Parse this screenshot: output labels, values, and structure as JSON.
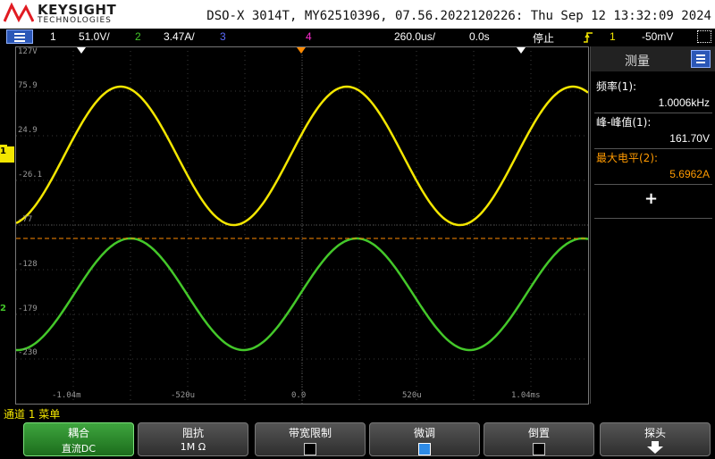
{
  "header": {
    "brand": "KEYSIGHT",
    "brand_sub": "TECHNOLOGIES",
    "device_info": "DSO-X 3014T, MY62510396, 07.56.2022120226: Thu Sep 12 13:32:09 2024"
  },
  "status_bar": {
    "ch1_num": "1",
    "ch1_scale": "51.0V/",
    "ch2_num": "2",
    "ch2_scale": "3.47A/",
    "ch3_num": "3",
    "ch4_num": "4",
    "timebase": "260.0us/",
    "delay": "0.0s",
    "run_state": "停止",
    "trigger_source": "1",
    "trigger_level": "-50mV"
  },
  "graticule": {
    "y_labels": [
      "127V",
      "75.9",
      "24.9",
      "-26.1",
      "-77",
      "-128",
      "-179",
      "-230"
    ],
    "x_labels": [
      "-1.04m",
      "-520u",
      "0.0",
      "520u",
      "1.04ms"
    ]
  },
  "channel_markers": {
    "ch1": "1",
    "ch2": "2"
  },
  "waveforms": {
    "ch1_color": "#f3e600",
    "ch2_color": "#44c82a",
    "reference_line_color": "#ff8a00"
  },
  "measure_panel": {
    "title": "测量",
    "items": [
      {
        "label": "频率(1):",
        "value": "1.0006kHz",
        "color": "#ffffff"
      },
      {
        "label": "峰-峰值(1):",
        "value": "161.70V",
        "color": "#ffffff"
      },
      {
        "label": "最大电平(2):",
        "value": "5.6962A",
        "color": "#ff9a00"
      }
    ],
    "add_symbol": "+"
  },
  "menu": {
    "title": "通道 1 菜单"
  },
  "softkeys": [
    {
      "title": "耦合",
      "value": "直流DC"
    },
    {
      "title": "阻抗",
      "value": "1M Ω"
    },
    {
      "title": "带宽限制",
      "checked": false
    },
    {
      "title": "微调",
      "checked": true
    },
    {
      "title": "倒置",
      "checked": false
    },
    {
      "title": "探头",
      "value": ""
    }
  ]
}
